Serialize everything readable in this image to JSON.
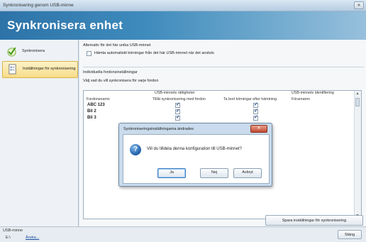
{
  "window": {
    "title": "Synkronisering genom USB-minne",
    "close": "✕"
  },
  "header": {
    "title": "Synkronisera enhet"
  },
  "sidebar": {
    "items": [
      {
        "label": "Synkronisera",
        "icon": "sync-check-icon"
      },
      {
        "label": "Inställningar för synkronisering",
        "icon": "settings-document-icon"
      }
    ]
  },
  "main": {
    "section1_title": "Alternativ för det här unika USB-minnet",
    "auto_fetch_label": "Hämta automatiskt körningar från det här USB-minnet när det ansluts",
    "auto_fetch_checked": false,
    "section2_title": "Individuella fordonsinställningar",
    "section2_subtitle": "Välj vad du vill synkronisera för varje fordon",
    "grid": {
      "group_rights": "USB-minnets rättigheter",
      "group_id": "USB-minnets identifiering",
      "col_vehicle": "Fordonsnamn",
      "col_allow": "Tillåt synkronisering med fordon",
      "col_delete": "Ta bort körningar efter hämtning",
      "col_driver": "Förarnamn",
      "rows": [
        {
          "name": "ABC 123",
          "allow": true,
          "delete": true
        },
        {
          "name": "Bil 2",
          "allow": true,
          "delete": true
        },
        {
          "name": "Bil 3",
          "allow": true,
          "delete": true
        }
      ]
    },
    "save_button": "Spara inställningar för synkronisering"
  },
  "bottom": {
    "label": "USB-minne",
    "drive": "E:\\",
    "change_link": "Ändra...",
    "close_button": "Stäng"
  },
  "dialog": {
    "title": "Synkroniseringsinställningarna ändrades",
    "message": "Vill du tilldela denna konfiguration till USB-minnet?",
    "buttons": {
      "yes": "Ja",
      "no": "Nej",
      "cancel": "Avbryt"
    }
  }
}
